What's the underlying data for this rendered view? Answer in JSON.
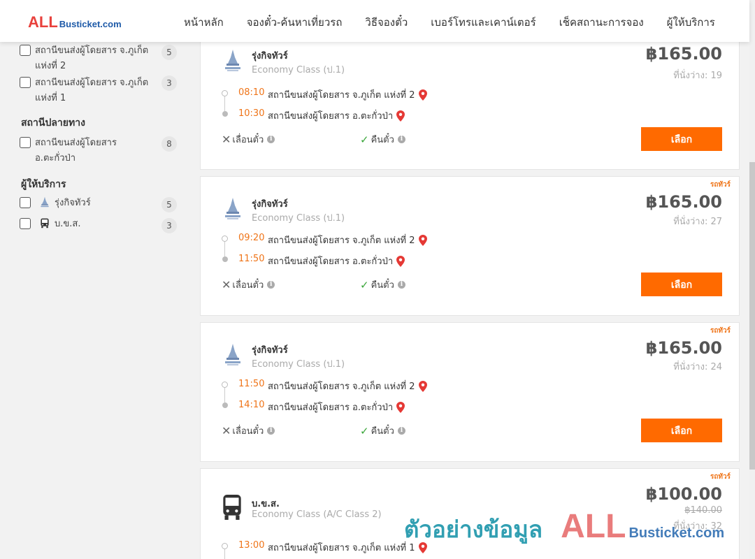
{
  "brand": {
    "logo_all": "ALL",
    "logo_rest": "Busticket.com"
  },
  "nav": [
    {
      "label": "หน้าหลัก"
    },
    {
      "label": "จองตั๋ว-ค้นหาเที่ยวรถ"
    },
    {
      "label": "วิธีจองตั๋ว"
    },
    {
      "label": "เบอร์โทรและเคาน์เตอร์"
    },
    {
      "label": "เช็คสถานะการจอง"
    },
    {
      "label": "ผู้ให้บริการ"
    }
  ],
  "sidebar": {
    "origin_items": [
      {
        "label": "สถานีขนส่งผู้โดยสาร จ.ภูเก็ต แห่งที่ 2",
        "count": "5"
      },
      {
        "label": "สถานีขนส่งผู้โดยสาร จ.ภูเก็ต แห่งที่ 1",
        "count": "3"
      }
    ],
    "destination_title": "สถานีปลายทาง",
    "destination_items": [
      {
        "label": "สถานีขนส่งผู้โดยสาร อ.ตะกั่วป่า",
        "count": "8"
      }
    ],
    "operator_title": "ผู้ให้บริการ",
    "operator_items": [
      {
        "label": "รุ่งกิจทัวร์",
        "count": "5",
        "icon": "rungkit-logo-icon"
      },
      {
        "label": "บ.ข.ส.",
        "count": "3",
        "icon": "bus-icon"
      }
    ]
  },
  "common": {
    "reschedule_label": "เลื่อนตั๋ว",
    "refund_label": "คืนตั๋ว",
    "select_label": "เลือก",
    "seats_prefix": "ที่นั่งว่าง: ",
    "tour_tag": "รถทัวร์"
  },
  "trips": [
    {
      "operator": "รุ่งกิจทัวร์",
      "bus_class": "Economy Class (ป.1)",
      "price": "฿165.00",
      "seats": "19",
      "tag": "",
      "old_price": "",
      "depart_time": "08:10",
      "depart_station": "สถานีขนส่งผู้โดยสาร จ.ภูเก็ต แห่งที่ 2",
      "arrive_time": "10:30",
      "arrive_station": "สถานีขนส่งผู้โดยสาร อ.ตะกั่วป่า"
    },
    {
      "operator": "รุ่งกิจทัวร์",
      "bus_class": "Economy Class (ป.1)",
      "price": "฿165.00",
      "seats": "27",
      "tag": "รถทัวร์",
      "old_price": "",
      "depart_time": "09:20",
      "depart_station": "สถานีขนส่งผู้โดยสาร จ.ภูเก็ต แห่งที่ 2",
      "arrive_time": "11:50",
      "arrive_station": "สถานีขนส่งผู้โดยสาร อ.ตะกั่วป่า"
    },
    {
      "operator": "รุ่งกิจทัวร์",
      "bus_class": "Economy Class (ป.1)",
      "price": "฿165.00",
      "seats": "24",
      "tag": "รถทัวร์",
      "old_price": "",
      "depart_time": "11:50",
      "depart_station": "สถานีขนส่งผู้โดยสาร จ.ภูเก็ต แห่งที่ 2",
      "arrive_time": "14:10",
      "arrive_station": "สถานีขนส่งผู้โดยสาร อ.ตะกั่วป่า"
    },
    {
      "operator": "บ.ข.ส.",
      "bus_class": "Economy Class (A/C Class 2)",
      "price": "฿100.00",
      "seats": "32",
      "tag": "รถทัวร์",
      "old_price": "฿140.00",
      "depart_time": "13:00",
      "depart_station": "สถานีขนส่งผู้โดยสาร จ.ภูเก็ต แห่งที่ 1"
    }
  ],
  "watermark": {
    "text": "ตัวอย่างข้อมูล",
    "all": "ALL",
    "rest": "Busticket.com"
  },
  "colors": {
    "accent": "#ff6a00",
    "time": "#ef7418",
    "brand_red": "#e8413c",
    "brand_blue": "#1e5aa8"
  }
}
